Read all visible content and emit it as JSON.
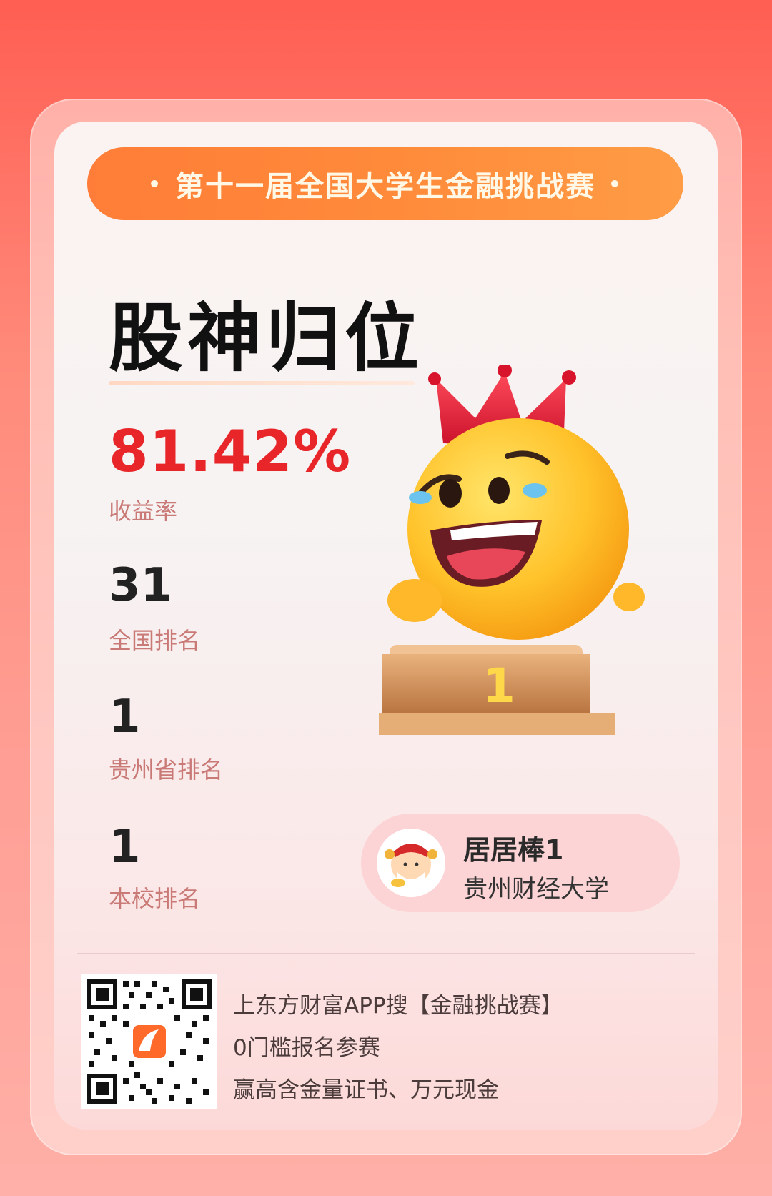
{
  "banner": {
    "title": "第十一届全国大学生金融挑战赛",
    "dot": "•"
  },
  "headline": "股神归位",
  "stats": {
    "profit_value": "81.42%",
    "profit_label": "收益率",
    "national_rank_value": "31",
    "national_rank_label": "全国排名",
    "province_rank_value": "1",
    "province_rank_label": "贵州省排名",
    "school_rank_value": "1",
    "school_rank_label": "本校排名"
  },
  "podium_number": "1",
  "user": {
    "name": "居居棒1",
    "school": "贵州财经大学"
  },
  "promo": {
    "line1": "上东方财富APP搜【金融挑战赛】",
    "line2": "0门槛报名参赛",
    "line3": "赢高含金量证书、万元现金"
  },
  "colors": {
    "accent_red": "#e8262a",
    "banner_orange": "#ff8a3a",
    "label_pink": "#c97a76"
  },
  "icons": {
    "mascot": "crowned-smiley-emoji-on-podium",
    "avatar": "god-of-wealth-avatar",
    "qr": "qr-code-with-app-logo"
  }
}
